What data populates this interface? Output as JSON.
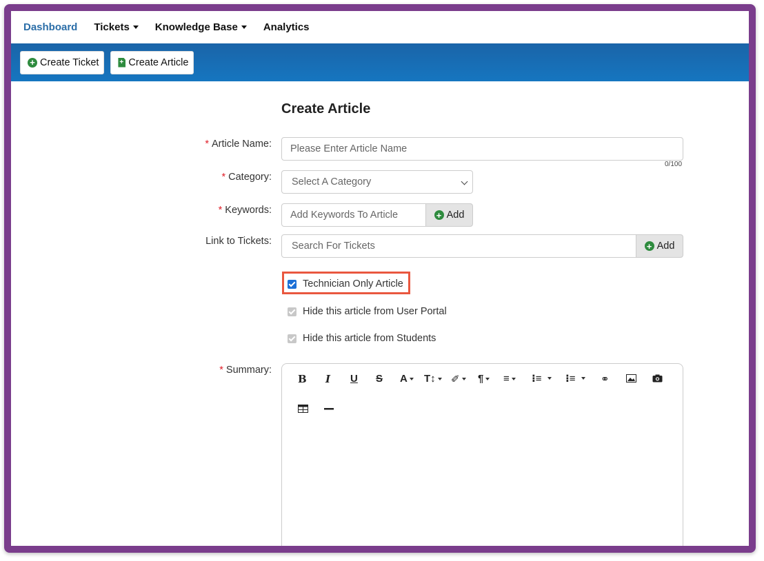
{
  "nav": {
    "items": [
      {
        "label": "Dashboard",
        "active": true,
        "dropdown": false
      },
      {
        "label": "Tickets",
        "active": false,
        "dropdown": true
      },
      {
        "label": "Knowledge Base",
        "active": false,
        "dropdown": true
      },
      {
        "label": "Analytics",
        "active": false,
        "dropdown": false
      }
    ]
  },
  "toolbar": {
    "create_ticket": "Create Ticket",
    "create_article": "Create Article"
  },
  "form": {
    "title": "Create Article",
    "article_name": {
      "label": "Article Name:",
      "required": "*",
      "placeholder": "Please Enter Article Name",
      "counter": "0/100"
    },
    "category": {
      "label": "Category:",
      "required": "*",
      "selected": "Select A Category"
    },
    "keywords": {
      "label": "Keywords:",
      "required": "*",
      "placeholder": "Add Keywords To Article",
      "add_label": "Add"
    },
    "link_tickets": {
      "label": "Link to Tickets:",
      "placeholder": "Search For Tickets",
      "add_label": "Add"
    },
    "checkboxes": [
      {
        "label": "Technician Only Article",
        "checked": true,
        "disabled": false,
        "highlighted": true
      },
      {
        "label": "Hide this article from User Portal",
        "checked": true,
        "disabled": true
      },
      {
        "label": "Hide this article from Students",
        "checked": true,
        "disabled": true
      }
    ],
    "summary": {
      "label": "Summary:",
      "required": "*"
    }
  },
  "editor_tools": [
    "bold-icon",
    "italic-icon",
    "underline-icon",
    "strikethrough-icon",
    "font-color-icon",
    "font-size-icon",
    "magic-wand-icon",
    "paragraph-icon",
    "align-icon",
    "ordered-list-icon",
    "unordered-list-icon",
    "link-icon",
    "image-icon",
    "camera-icon",
    "table-icon",
    "horizontal-rule-icon"
  ],
  "colors": {
    "accent": "#2b6ea8",
    "frame": "#7a3d8c",
    "toolbar": "#1a64a8",
    "highlight": "#e9573f",
    "required": "#e0202a",
    "success": "#2e8b3e"
  }
}
